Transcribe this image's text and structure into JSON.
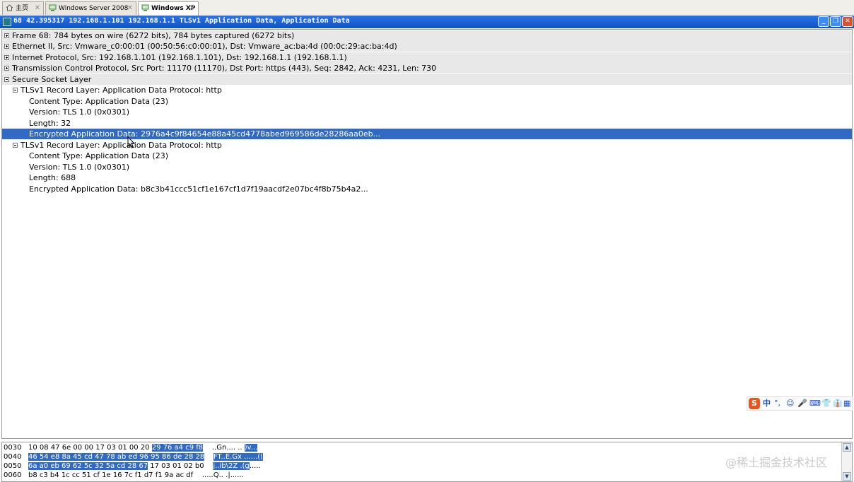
{
  "tabs": [
    {
      "label": "主页",
      "icon": "home-icon"
    },
    {
      "label": "Windows Server 2008",
      "icon": "vm-icon"
    },
    {
      "label": "Windows XP",
      "icon": "vm-icon"
    }
  ],
  "tab_close": "✕",
  "window": {
    "title": "68 42.395317 192.168.1.101 192.168.1.1 TLSv1 Application Data, Application Data",
    "buttons": {
      "minimize": "_",
      "restore": "❐",
      "close": "✕"
    }
  },
  "tree": [
    "Frame 68: 784 bytes on wire (6272 bits), 784 bytes captured (6272 bits)",
    "Ethernet II, Src: Vmware_c0:00:01 (00:50:56:c0:00:01), Dst: Vmware_ac:ba:4d (00:0c:29:ac:ba:4d)",
    "Internet Protocol, Src: 192.168.1.101 (192.168.1.101), Dst: 192.168.1.1 (192.168.1.1)",
    "Transmission Control Protocol, Src Port: 11170 (11170), Dst Port: https (443), Seq: 2842, Ack: 4231, Len: 730",
    "Secure Socket Layer",
    "TLSv1 Record Layer: Application Data Protocol: http",
    "Content Type: Application Data (23)",
    "Version: TLS 1.0 (0x0301)",
    "Length: 32",
    "Encrypted Application Data: 2976a4c9f84654e88a45cd4778abed969586de28286aa0eb...",
    "TLSv1 Record Layer: Application Data Protocol: http",
    "Content Type: Application Data (23)",
    "Version: TLS 1.0 (0x0301)",
    "Length: 688",
    "Encrypted Application Data: b8c3b41ccc51cf1e167cf1d7f19aacdf2e07bc4f8b75b4a2..."
  ],
  "ime": {
    "logo": "S",
    "items": [
      "中",
      "°,",
      "☺",
      "🎤",
      "⌨",
      "👕",
      "👔",
      "▦"
    ]
  },
  "hex": [
    {
      "offset": "0030",
      "bytes_a": "10 08 47 6e 00 00 17 03  01 00 20",
      "bytes_b": "29 76 a4 c9 f8",
      "ascii_a": "..Gn.... .. ",
      "ascii_b": ")v..."
    },
    {
      "offset": "0040",
      "bytes_a": "",
      "bytes_b": "46 54 e8 8a 45 cd 47 78  ab ed 96 95 86 de 28 28",
      "ascii_a": "",
      "ascii_b": "FT..E.Gx ......(("
    },
    {
      "offset": "0050",
      "bytes_a": "",
      "bytes_b": "6a a0 eb 69 62 5c 32 5a  cd 28 67",
      "bytes_c": "17 03 01 02 b0",
      "ascii_a": "",
      "ascii_b": "j..ib\\2Z .(g",
      "ascii_c": "....."
    },
    {
      "offset": "0060",
      "bytes_a": "b8 c3 b4 1c cc 51 cf 1e  16 7c f1 d7 f1 9a ac df",
      "ascii_a": ".....Q.. .|......"
    }
  ],
  "watermark": "@稀土掘金技术社区"
}
